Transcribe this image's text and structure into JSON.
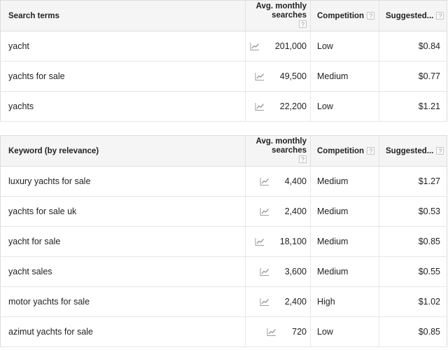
{
  "columns": {
    "avg_monthly_searches_line1": "Avg. monthly",
    "avg_monthly_searches_line2": "searches",
    "competition": "Competition",
    "suggested_bid": "Suggested...",
    "help_glyph": "?"
  },
  "tables": [
    {
      "id": "search-terms-table",
      "first_column_header": "Search terms",
      "rows": [
        {
          "term": "yacht",
          "searches": "201,000",
          "competition": "Low",
          "bid": "$0.84"
        },
        {
          "term": "yachts for sale",
          "searches": "49,500",
          "competition": "Medium",
          "bid": "$0.77"
        },
        {
          "term": "yachts",
          "searches": "22,200",
          "competition": "Low",
          "bid": "$1.21"
        }
      ]
    },
    {
      "id": "keyword-relevance-table",
      "first_column_header": "Keyword (by relevance)",
      "rows": [
        {
          "term": "luxury yachts for sale",
          "searches": "4,400",
          "competition": "Medium",
          "bid": "$1.27"
        },
        {
          "term": "yachts for sale uk",
          "searches": "2,400",
          "competition": "Medium",
          "bid": "$0.53"
        },
        {
          "term": "yacht for sale",
          "searches": "18,100",
          "competition": "Medium",
          "bid": "$0.85"
        },
        {
          "term": "yacht sales",
          "searches": "3,600",
          "competition": "Medium",
          "bid": "$0.55"
        },
        {
          "term": "motor yachts for sale",
          "searches": "2,400",
          "competition": "High",
          "bid": "$1.02"
        },
        {
          "term": "azimut yachts for sale",
          "searches": "720",
          "competition": "Low",
          "bid": "$0.85"
        }
      ]
    }
  ],
  "icons": {
    "trend": "trend-chart-icon"
  },
  "colors": {
    "header_background": "#f5f5f5",
    "border": "#dcdcdc",
    "row_border": "#e6e6e6",
    "text": "#222222",
    "help_icon_border": "#c6c6c6"
  }
}
